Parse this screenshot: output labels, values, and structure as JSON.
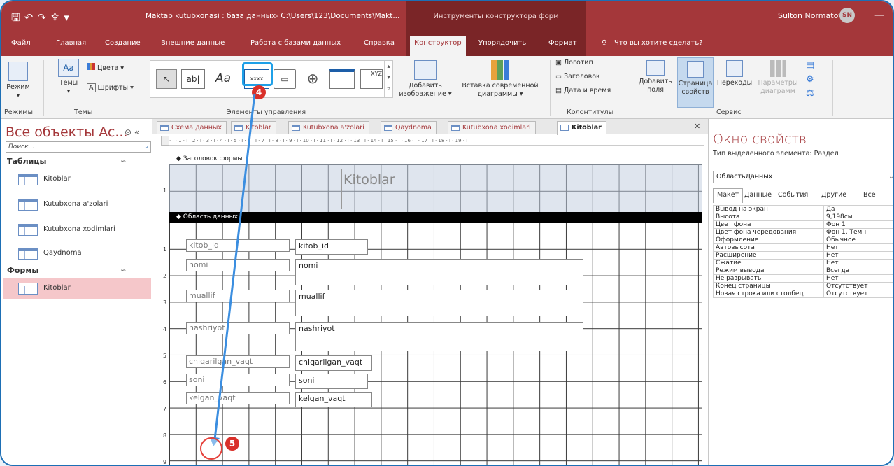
{
  "titlebar": {
    "title": "Maktab kutubxonasi : база данных- C:\\Users\\123\\Documents\\Makt...",
    "context_label": "Инструменты конструктора форм",
    "user_name": "Sulton Normatov",
    "user_initials": "SN",
    "minimize": "—"
  },
  "tabs": [
    "Файл",
    "Главная",
    "Создание",
    "Внешние данные",
    "Работа с базами данных",
    "Справка",
    "Конструктор",
    "Упорядочить",
    "Формат",
    "Что вы хотите сделать?"
  ],
  "ribbon": {
    "rezhim": "Режим",
    "temy": "Темы",
    "tsveta": "Цвета",
    "shrifty": "Шрифты",
    "group_rezhimy": "Режимы",
    "group_temy": "Темы",
    "gallery_ab": "ab|",
    "gallery_aa": "Aa",
    "gallery_xxxx": "xxxx",
    "gallery_xyz": "XYZ",
    "add_image_1": "Добавить",
    "add_image_2": "изображение",
    "insert_chart_1": "Вставка современной",
    "insert_chart_2": "диаграммы",
    "group_elements": "Элементы управления",
    "logo": "Логотип",
    "header": "Заголовок",
    "datetime": "Дата и время",
    "group_kolontituly": "Колонтитулы",
    "add_fields_1": "Добавить",
    "add_fields_2": "поля",
    "prop_sheet_1": "Страница",
    "prop_sheet_2": "свойств",
    "transitions": "Переходы",
    "params_1": "Параметры",
    "params_2": "диаграмм",
    "group_servis": "Сервис"
  },
  "nav": {
    "title": "Все объекты Ac...",
    "search_placeholder": "Поиск...",
    "section_tables": "Таблицы",
    "tables": [
      "Kitoblar",
      "Kutubxona a'zolari",
      "Kutubxona xodimlari",
      "Qaydnoma"
    ],
    "section_forms": "Формы",
    "forms": [
      "Kitoblar"
    ]
  },
  "doc_tabs": [
    "Схема данных",
    "Kitoblar",
    "Kutubxona a'zolari",
    "Qaydnoma",
    "Kutubxona xodimlari",
    "Kitoblar"
  ],
  "ruler_text": "· ı · 1 · ı · 2 · ı · 3 · ı · 4 · ı · 5 · ı · 6 · ı · 7 · ı · 8 · ı · 9 · ı · 10 · ı · 11 · ı · 12 · ı · 13 · ı · 14 · ı · 15 · ı · 16 · ı · 17 · ı · 18 · ı · 19 · ı",
  "vruler": [
    "1",
    "1",
    "2",
    "3",
    "4",
    "5",
    "6",
    "7",
    "8",
    "9"
  ],
  "form": {
    "header_section": "Заголовок формы",
    "detail_section": "Область данных",
    "title": "Kitoblar",
    "fields": [
      {
        "label": "kitob_id",
        "value": "kitob_id"
      },
      {
        "label": "nomi",
        "value": "nomi"
      },
      {
        "label": "muallif",
        "value": "muallif"
      },
      {
        "label": "nashriyot",
        "value": "nashriyot"
      },
      {
        "label": "chiqarilgan_vaqt",
        "value": "chiqarilgan_vaqt"
      },
      {
        "label": "soni",
        "value": "soni"
      },
      {
        "label": "kelgan_vaqt",
        "value": "kelgan_vaqt"
      }
    ]
  },
  "props": {
    "title": "Окно свойств",
    "type_label": "Тип выделенного элемента:  Раздел",
    "selected": "ОбластьДанных",
    "tabs": [
      "Макет",
      "Данные",
      "События",
      "Другие",
      "Все"
    ],
    "rows": [
      [
        "Вывод на экран",
        "Да"
      ],
      [
        "Высота",
        "9,198см"
      ],
      [
        "Цвет фона",
        "Фон 1"
      ],
      [
        "Цвет фона чередования",
        "Фон 1, Темн"
      ],
      [
        "Оформление",
        "Обычное"
      ],
      [
        "Автовысота",
        "Нет"
      ],
      [
        "Расширение",
        "Нет"
      ],
      [
        "Сжатие",
        "Нет"
      ],
      [
        "Режим вывода",
        "Всегда"
      ],
      [
        "Не разрывать",
        "Нет"
      ],
      [
        "Конец страницы",
        "Отсутствует"
      ],
      [
        "Новая строка или столбец",
        "Отсутствует"
      ]
    ]
  },
  "annotations": {
    "step4": "4",
    "step5": "5"
  },
  "colors": {
    "accent": "#a4373a",
    "highlight": "#1ea0e8",
    "badge": "#d9302a"
  }
}
